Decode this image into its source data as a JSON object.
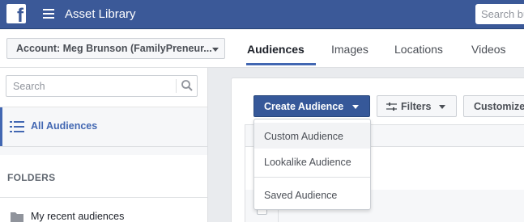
{
  "topbar": {
    "logo_letter": "f",
    "app_title": "Asset Library",
    "search_placeholder": "Search bu"
  },
  "account": {
    "label": "Account: Meg Brunson (FamilyPreneur..."
  },
  "tabs": [
    {
      "label": "Audiences",
      "active": true
    },
    {
      "label": "Images",
      "active": false
    },
    {
      "label": "Locations",
      "active": false
    },
    {
      "label": "Videos",
      "active": false
    }
  ],
  "sidebar": {
    "search_placeholder": "Search",
    "all_audiences": "All Audiences",
    "folders_heading": "FOLDERS",
    "folder_items": [
      "My recent audiences"
    ]
  },
  "toolbar": {
    "create_label": "Create Audience",
    "filters_label": "Filters",
    "customize_label": "Customize"
  },
  "dropdown": {
    "items": [
      "Custom Audience",
      "Lookalike Audience",
      "Saved Audience"
    ]
  },
  "colors": {
    "brand": "#3b5998",
    "accent": "#4267b2",
    "button_primary": "#365899"
  }
}
